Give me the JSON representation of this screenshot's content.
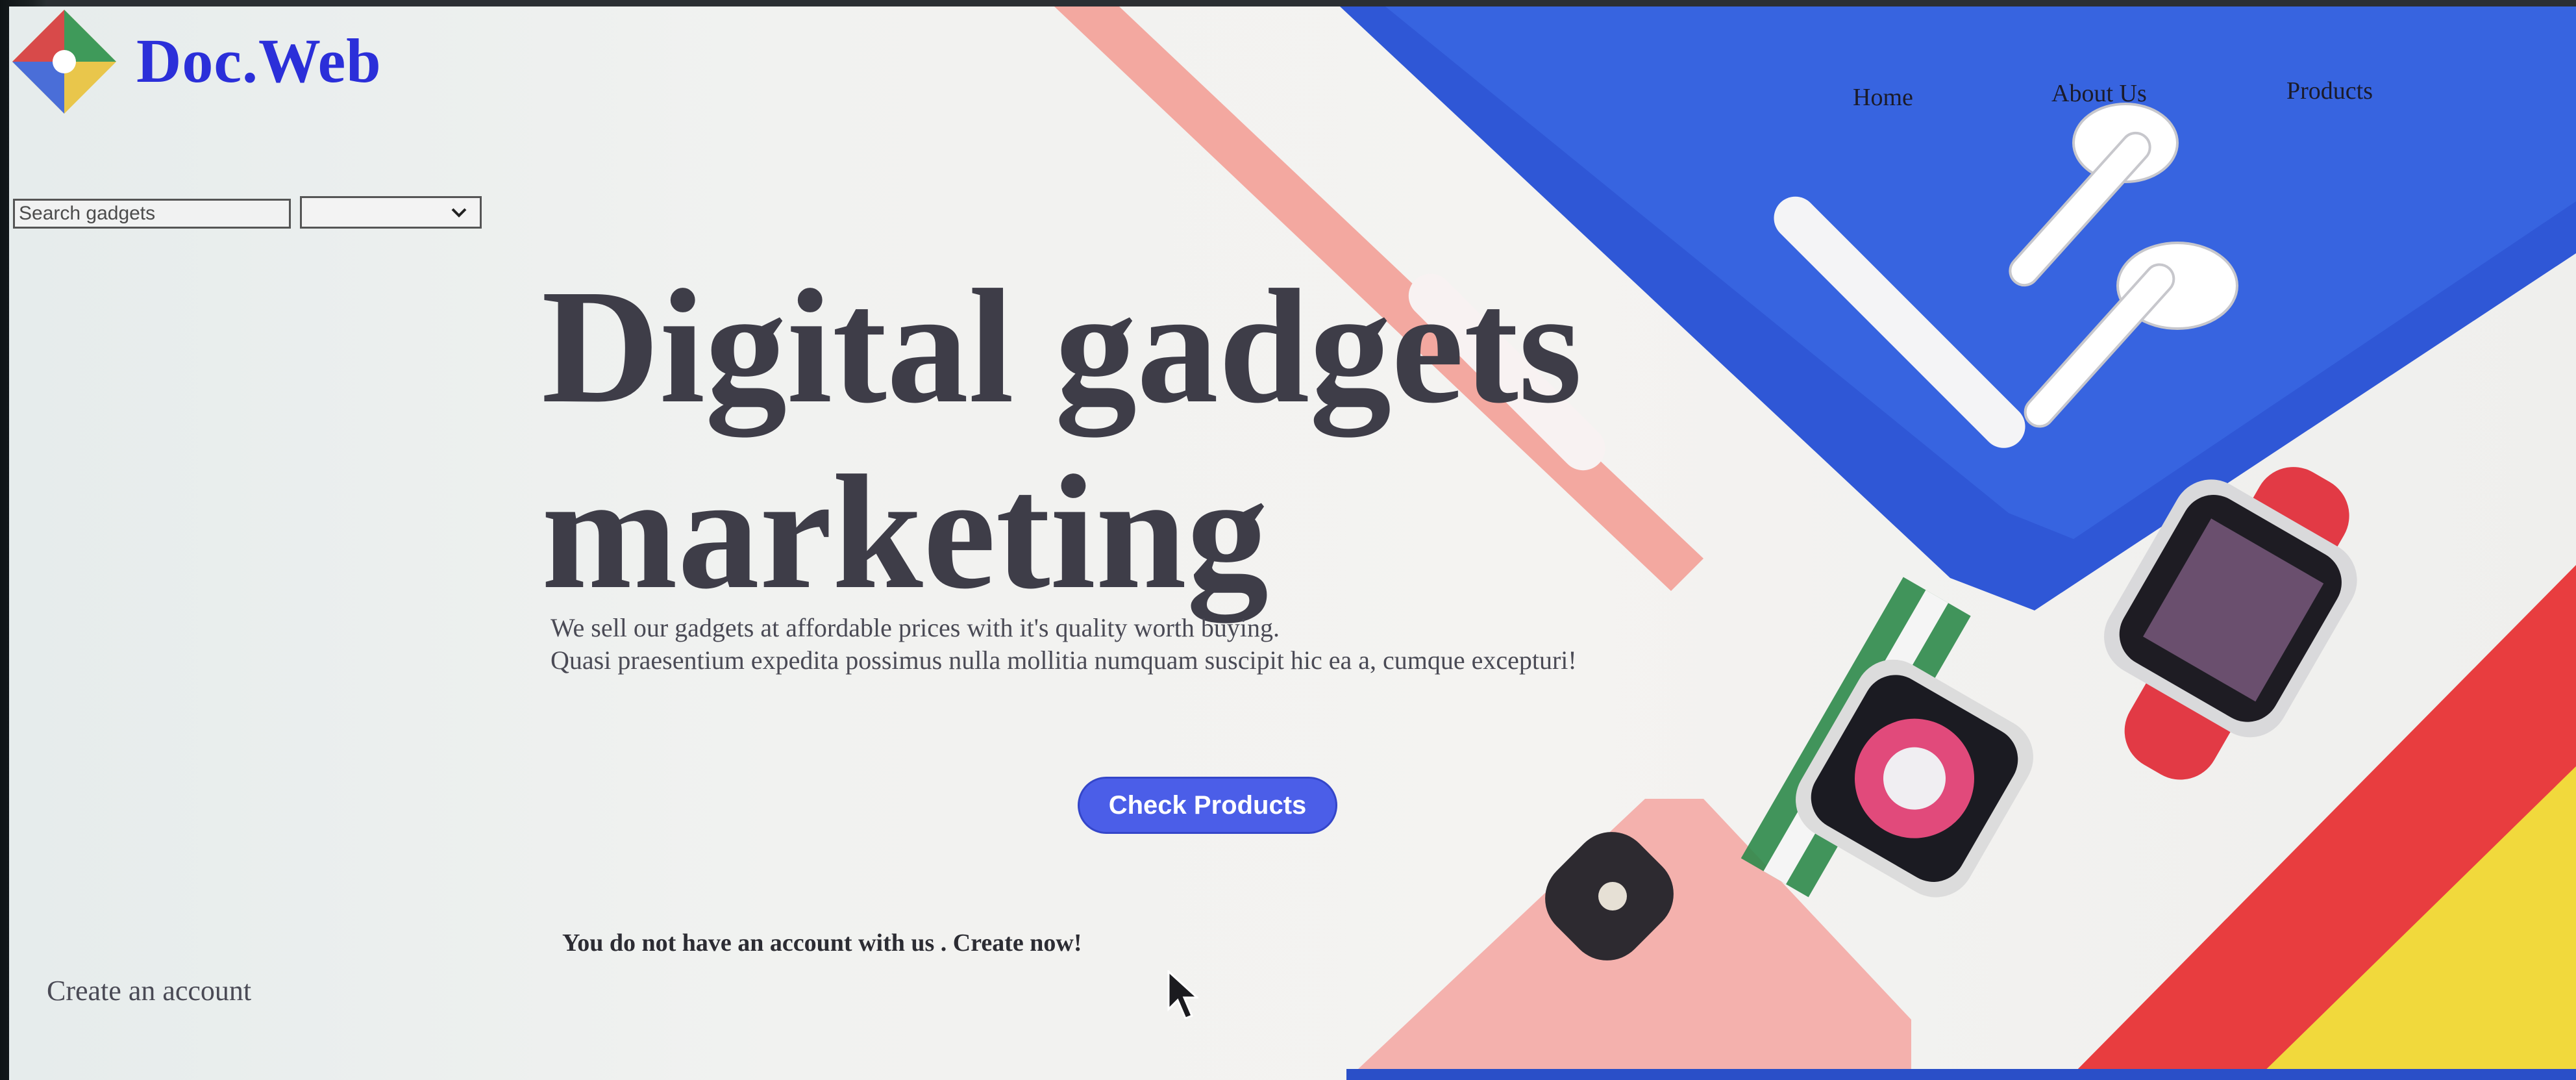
{
  "brand": {
    "name": "Doc.Web"
  },
  "nav": {
    "items": [
      {
        "label": "Home"
      },
      {
        "label": "About Us"
      },
      {
        "label": "Products"
      }
    ]
  },
  "search": {
    "placeholder": "Search gadgets",
    "category_value": ""
  },
  "hero": {
    "title_line1": "Digital gadgets",
    "title_line2": "marketing",
    "subtitle_line1": "We sell our gadgets at affordable prices with it's quality worth buying.",
    "subtitle_line2": "Quasi praesentium expedita possimus nulla mollitia numquam suscipit hic ea a, cumque excepturi!",
    "cta_label": "Check Products"
  },
  "account": {
    "note": "You do not have an account with us . Create now!",
    "create_label": "Create an account"
  },
  "colors": {
    "brand": "#2b2fd9",
    "cta": "#4b5ee8",
    "heading": "#3e3d48"
  }
}
